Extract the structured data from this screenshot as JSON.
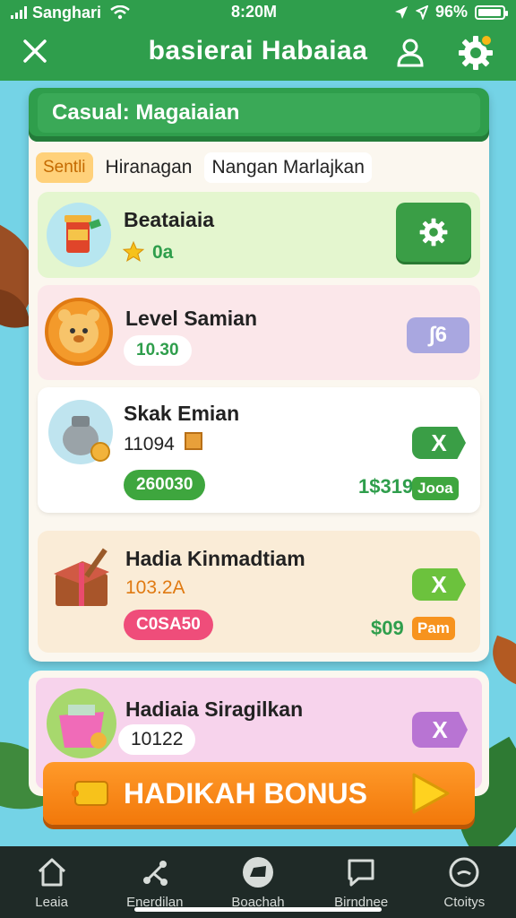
{
  "status_bar": {
    "carrier": "Sanghari",
    "time": "8:20M",
    "battery": "96%",
    "battery_level": 0.96
  },
  "header": {
    "title": "basierai Habaiaa",
    "close_icon": "close-icon",
    "user_icon": "user-icon",
    "settings_icon": "gear-icon"
  },
  "panel": {
    "title": "Casual: Magaiaian",
    "filters": [
      "Sentli",
      "Hiranagan",
      "Nangan Marlajkan"
    ]
  },
  "cards": [
    {
      "name": "Beataiaia",
      "value": "0a",
      "button_icon": "gear-icon",
      "color": "#e4f6cf"
    },
    {
      "name": "Level Samian",
      "value": "10.30",
      "button_label": "∫6",
      "color": "#fbe7ea"
    },
    {
      "name": "Skak Emian",
      "value": "11094",
      "pill": "260030",
      "button_label": "X",
      "price": "1$319",
      "tag": "Jooa",
      "color": "#ffffff"
    },
    {
      "name": "Hadia Kinmadtiam",
      "value": "103.2A",
      "pill": "C0SA50",
      "button_label": "X",
      "price": "$09",
      "tag": "Pam",
      "color": "#faecd7"
    },
    {
      "name": "Hadiaia Siragilkan",
      "value": "10122",
      "button_label": "X",
      "color": "#f7d3ec"
    }
  ],
  "bonus": {
    "label": "HADIKAH BONUS"
  },
  "nav": [
    {
      "label": "Leaia",
      "icon": "home-icon"
    },
    {
      "label": "Enerdilan",
      "icon": "share-icon"
    },
    {
      "label": "Boachah",
      "icon": "box-icon"
    },
    {
      "label": "Birndnee",
      "icon": "chat-icon"
    },
    {
      "label": "Ctoitys",
      "icon": "smile-icon"
    }
  ]
}
